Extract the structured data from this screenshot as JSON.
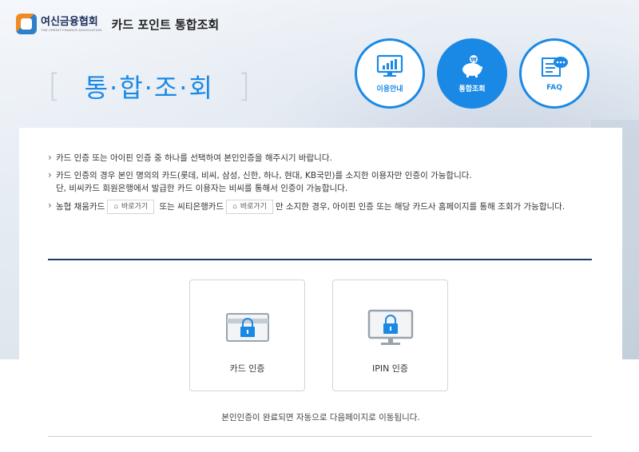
{
  "header": {
    "logo_title": "여신금융협회",
    "logo_sub": "THE CREDIT FINANCE ASSOCIATION",
    "app_title": "카드 포인트 통합조회"
  },
  "page_heading": {
    "bracket_left": "[",
    "title": "통·합·조·회",
    "bracket_right": "]"
  },
  "nav": [
    {
      "label": "이용안내",
      "icon": "chart-monitor-icon",
      "active": false
    },
    {
      "label": "통합조회",
      "icon": "piggy-bank-icon",
      "active": true
    },
    {
      "label": "FAQ",
      "icon": "faq-chat-icon",
      "active": false
    }
  ],
  "notices": {
    "n1": "카드 인증 또는 아이핀 인증 중 하나를 선택하여 본인인증을 해주시기 바랍니다.",
    "n2_line1": "카드 인증의 경우 본인 명의의 카드(롯데, 비씨, 삼성, 신한, 하나, 현대, KB국민)를 소지한 이용자만 인증이 가능합니다.",
    "n2_line2": "단, 비씨카드 회원은행에서 발급한 카드 이용자는 비씨를 통해서 인증이 가능합니다.",
    "n3_part1": "농협 채움카드",
    "n3_part2": "또는 씨티은행카드",
    "n3_part3": "만 소지한 경우, 아이핀 인증 또는 해당 카드사 홈페이지를 통해 조회가 가능합니다.",
    "goto_label": "바로가기"
  },
  "auth": {
    "card_label": "카드 인증",
    "ipin_label": "IPIN 인증"
  },
  "footer_msg": "본인인증이 완료되면 자동으로 다음페이지로 이동됩니다.",
  "colors": {
    "accent": "#1a89e6",
    "navy": "#1d3b6b"
  }
}
